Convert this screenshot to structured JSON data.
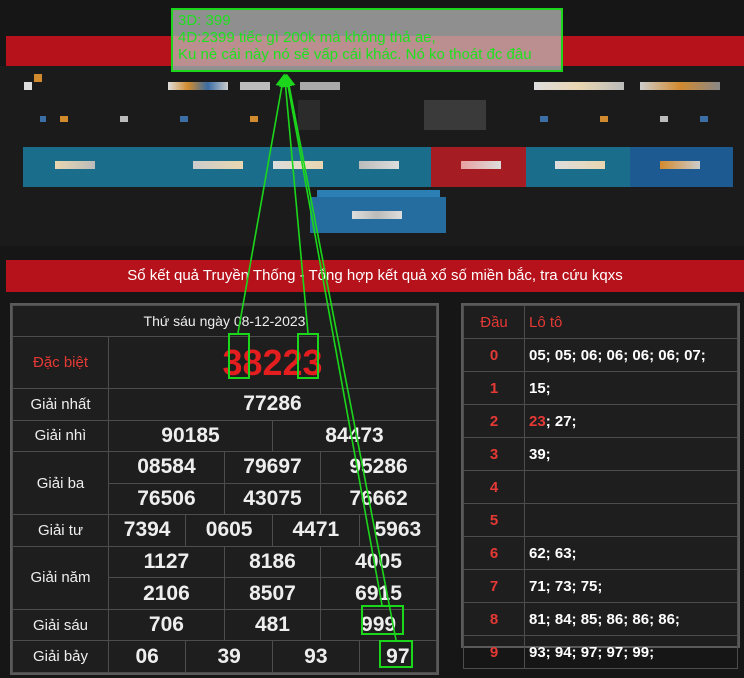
{
  "banner": {
    "text": "Sổ kết quả Truyền Thống - Tổng hợp kết quả xổ số miền bắc, tra cứu kqxs"
  },
  "results": {
    "date": "Thứ sáu ngày 08-12-2023",
    "special": {
      "label": "Đặc biệt",
      "value": "38223"
    },
    "first": {
      "label": "Giải nhất",
      "values": [
        "77286"
      ]
    },
    "second": {
      "label": "Giải nhì",
      "values": [
        "90185",
        "84473"
      ]
    },
    "third": {
      "label": "Giải ba",
      "values": [
        "08584",
        "79697",
        "95286",
        "76506",
        "43075",
        "76662"
      ]
    },
    "fourth": {
      "label": "Giải tư",
      "values": [
        "7394",
        "0605",
        "4471",
        "5963"
      ]
    },
    "fifth": {
      "label": "Giải năm",
      "values": [
        "1127",
        "8186",
        "4005",
        "2106",
        "8507",
        "6915"
      ]
    },
    "sixth": {
      "label": "Giải sáu",
      "values": [
        "706",
        "481",
        "999"
      ]
    },
    "seventh": {
      "label": "Giải bảy",
      "values": [
        "06",
        "39",
        "93",
        "97"
      ]
    }
  },
  "loto": {
    "head_label": "Đầu",
    "values_label": "Lô tô",
    "rows": [
      {
        "head": "0",
        "values": "05; 05; 06; 06; 06; 06; 07;"
      },
      {
        "head": "1",
        "values": "15;"
      },
      {
        "head": "2",
        "values_highlight": "23",
        "values": "; 27;"
      },
      {
        "head": "3",
        "values": "39;"
      },
      {
        "head": "4",
        "values": ""
      },
      {
        "head": "5",
        "values": ""
      },
      {
        "head": "6",
        "values": "62; 63;"
      },
      {
        "head": "7",
        "values": "71; 73; 75;"
      },
      {
        "head": "8",
        "values": "81; 84; 85; 86; 86; 86;"
      },
      {
        "head": "9",
        "values": "93; 94; 97; 97; 99;"
      }
    ]
  },
  "annotation": {
    "line1": "3D: 399",
    "line2": "4D:2399 tiếc gì 200k mà không thả ae,",
    "line3": "Ku nè cái này nó sẽ vấp cái khác. Nó ko thoát đc đâu"
  },
  "colors": {
    "annotation_green": "#1cd61c",
    "banner_red": "#b5121b",
    "special_red": "#e41e1e"
  }
}
